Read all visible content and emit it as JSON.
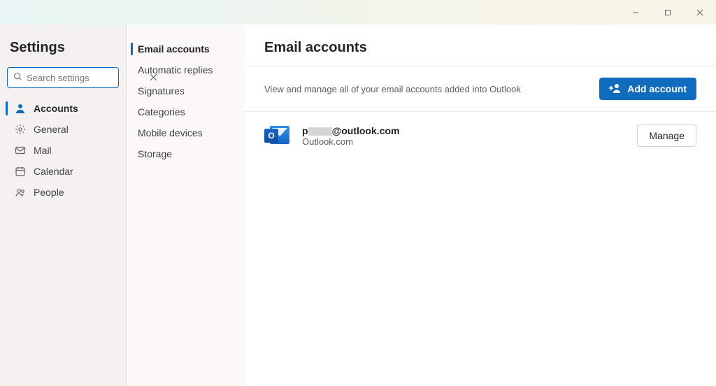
{
  "window": {
    "minimize": "–",
    "maximize": "▢",
    "close": "✕"
  },
  "sidebar": {
    "title": "Settings",
    "search": {
      "placeholder": "Search settings"
    },
    "items": [
      {
        "label": "Accounts",
        "active": true
      },
      {
        "label": "General",
        "active": false
      },
      {
        "label": "Mail",
        "active": false
      },
      {
        "label": "Calendar",
        "active": false
      },
      {
        "label": "People",
        "active": false
      }
    ]
  },
  "subnav": {
    "items": [
      {
        "label": "Email accounts",
        "active": true
      },
      {
        "label": "Automatic replies",
        "active": false
      },
      {
        "label": "Signatures",
        "active": false
      },
      {
        "label": "Categories",
        "active": false
      },
      {
        "label": "Mobile devices",
        "active": false
      },
      {
        "label": "Storage",
        "active": false
      }
    ]
  },
  "main": {
    "title": "Email accounts",
    "description": "View and manage all of your email accounts added into Outlook",
    "add_button": "Add account",
    "accounts": [
      {
        "email_prefix": "p",
        "email_suffix": "@outlook.com",
        "type": "Outlook.com",
        "manage_label": "Manage"
      }
    ]
  }
}
